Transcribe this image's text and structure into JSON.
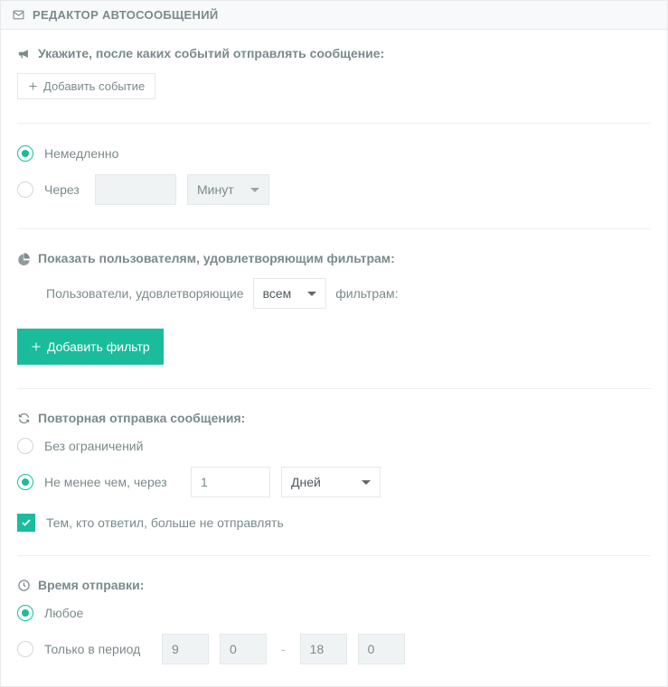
{
  "header": {
    "title": "РЕДАКТОР АВТОСООБЩЕНИЙ"
  },
  "events": {
    "heading": "Укажите, после каких событий отправлять сообщение:",
    "addButton": "Добавить событие"
  },
  "timing": {
    "immediatelyLabel": "Немедленно",
    "afterLabel": "Через",
    "afterValue": "",
    "afterUnit": "Минут"
  },
  "filters": {
    "heading": "Показать пользователям, удовлетворяющим фильтрам:",
    "prefix": "Пользователи, удовлетворяющие",
    "mode": "всем",
    "suffix": "фильтрам:",
    "addButton": "Добавить фильтр"
  },
  "repeat": {
    "heading": "Повторная отправка сообщения:",
    "unlimitedLabel": "Без ограничений",
    "notLessLabel": "Не менее чем, через",
    "notLessValue": "1",
    "notLessUnit": "Дней",
    "suppressReplied": "Тем, кто ответил, больше не отправлять"
  },
  "sendTime": {
    "heading": "Время отправки:",
    "anyLabel": "Любое",
    "periodLabel": "Только в период",
    "fromHour": "9",
    "fromMin": "0",
    "toHour": "18",
    "toMin": "0"
  }
}
